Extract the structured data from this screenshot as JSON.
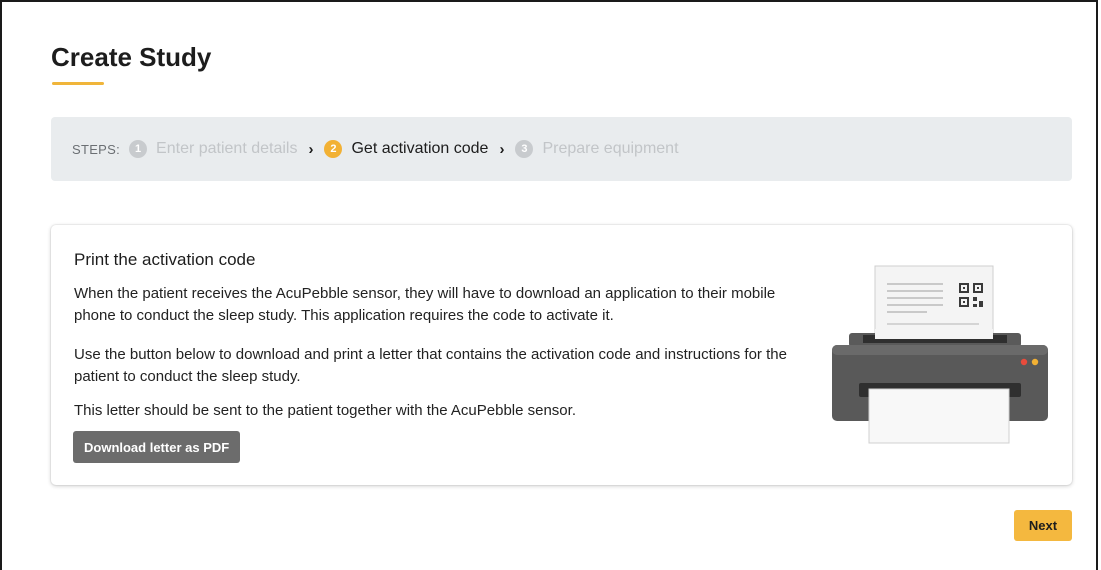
{
  "page": {
    "title": "Create Study",
    "accent_color": "#f0b53a"
  },
  "steps": {
    "label": "STEPS:",
    "items": [
      {
        "number": "1",
        "label": "Enter patient details",
        "state": "inactive"
      },
      {
        "number": "2",
        "label": "Get activation code",
        "state": "active"
      },
      {
        "number": "3",
        "label": "Prepare equipment",
        "state": "inactive"
      }
    ]
  },
  "card": {
    "title": "Print the activation code",
    "paragraphs": [
      "When the patient receives the AcuPebble sensor, they will have to download an application to their mobile phone to conduct the sleep study. This application requires the code to activate it.",
      "Use the button below to download and print a letter that contains the activation code and instructions for the patient to conduct the sleep study.",
      "This letter should be sent to the patient together with the AcuPebble sensor."
    ],
    "download_button": "Download letter as PDF",
    "illustration": "printer-icon"
  },
  "footer": {
    "next_button": "Next"
  }
}
